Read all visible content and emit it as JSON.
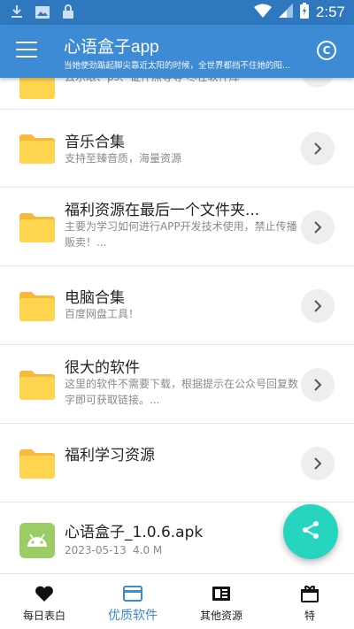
{
  "statusbar": {
    "time": "2:57"
  },
  "appbar": {
    "title": "心语盒子app",
    "subtitle": "当她使劲踮起脚尖靠近太阳的时候，全世界都挡不住她的阳..."
  },
  "list": {
    "partial_desc": "云乐眼、ps、证件照等等 尽在软件库",
    "items": [
      {
        "title": "音乐合集",
        "desc": "支持至臻音质，海量资源"
      },
      {
        "title": "福利资源在最后一个文件夹...",
        "desc": "主要为学习如何进行APP开发技术使用，禁止传播贩卖！..."
      },
      {
        "title": "电脑合集",
        "desc": "百度网盘工具！"
      },
      {
        "title": "很大的软件",
        "desc": "这里的软件不需要下载，根据提示在公众号回复数字即可获取链接。..."
      },
      {
        "title": "福利学习资源",
        "desc": ""
      }
    ],
    "apk": {
      "title": "心语盒子_1.0.6.apk",
      "date": "2023-05-13",
      "size": "4.0 M"
    }
  },
  "bottomnav": {
    "items": [
      {
        "label": "每日表白",
        "icon": "heart-icon"
      },
      {
        "label": "优质软件",
        "icon": "card-icon",
        "active": true
      },
      {
        "label": "其他资源",
        "icon": "newspaper-icon"
      },
      {
        "label": "特",
        "icon": "gift-icon"
      }
    ]
  },
  "colors": {
    "primary": "#3d8ad5",
    "statusbar": "#2f77bf",
    "fab": "#25d5c0",
    "folder": "#ffd54f",
    "android": "#9ccc65"
  }
}
